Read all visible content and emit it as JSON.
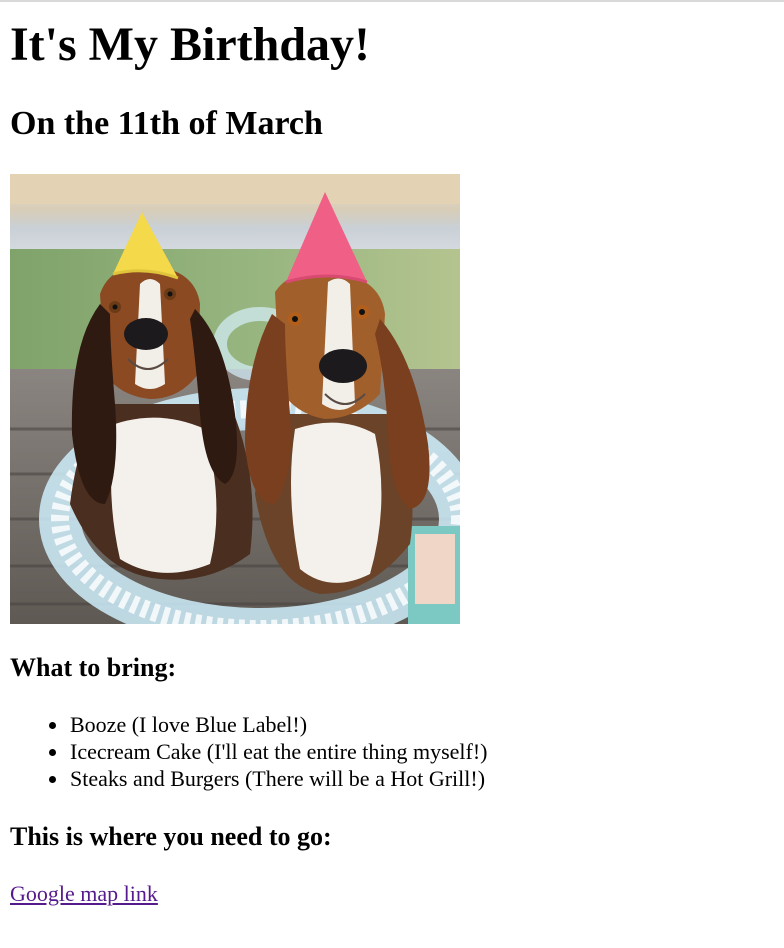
{
  "page": {
    "title": "It's My Birthday!",
    "subtitle": "On the 11th of March"
  },
  "photo": {
    "description_icon": "birthday-dogs-photo"
  },
  "bring": {
    "heading": "What to bring:",
    "items": [
      "Booze (I love Blue Label!)",
      "Icecream Cake (I'll eat the entire thing myself!)",
      "Steaks and Burgers (There will be a Hot Grill!)"
    ]
  },
  "location": {
    "heading": "This is where you need to go:",
    "link_text": "Google map link"
  },
  "colors": {
    "link_visited": "#551a8b",
    "text": "#000000",
    "background": "#ffffff"
  }
}
